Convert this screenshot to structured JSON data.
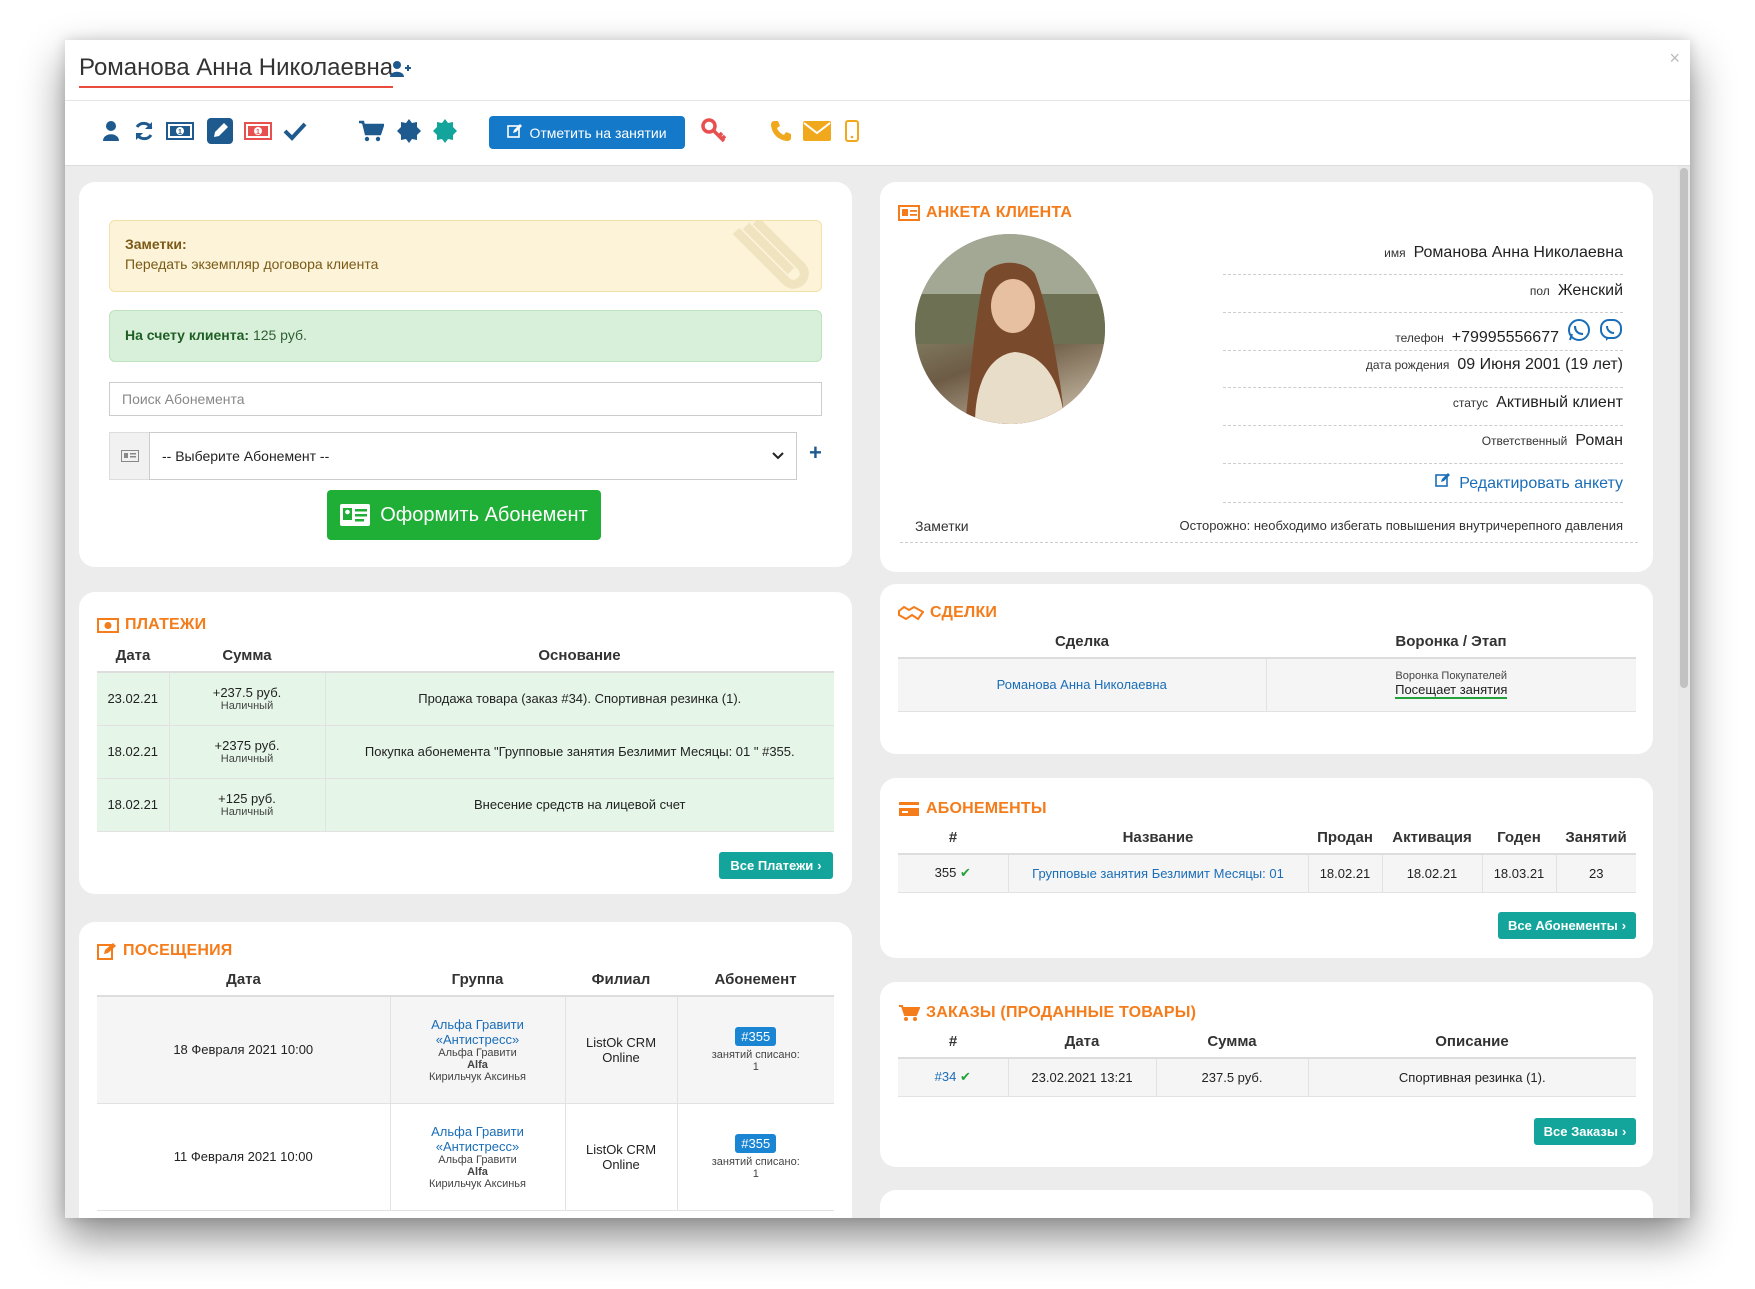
{
  "header": {
    "title": "Романова Анна Николаевна",
    "mark_button": "Отметить на занятии",
    "close": "×"
  },
  "notes": {
    "title": "Заметки:",
    "text": "Передать экземпляр договора клиента"
  },
  "balance": {
    "label": "На счету клиента:",
    "value": "125 руб."
  },
  "search": {
    "placeholder": "Поиск Абонемента"
  },
  "select": {
    "value": "-- Выберите Абонемент --",
    "add": "+"
  },
  "create_button": "Оформить Абонемент",
  "payments": {
    "title": "ПЛАТЕЖИ",
    "columns": [
      "Дата",
      "Сумма",
      "Основание"
    ],
    "rows": [
      {
        "date": "23.02.21",
        "sum": "+237.5 руб.",
        "method": "Наличный",
        "basis": "Продажа товара (заказ #34). Спортивная резинка (1)."
      },
      {
        "date": "18.02.21",
        "sum": "+2375 руб.",
        "method": "Наличный",
        "basis": "Покупка абонемента \"Групповые занятия Безлимит Месяцы: 01 \" #355."
      },
      {
        "date": "18.02.21",
        "sum": "+125 руб.",
        "method": "Наличный",
        "basis": "Внесение средств на лицевой счет"
      }
    ],
    "all_button": "Все Платежи"
  },
  "visits": {
    "title": "ПОСЕЩЕНИЯ",
    "columns": [
      "Дата",
      "Группа",
      "Филиал",
      "Абонемент"
    ],
    "rows": [
      {
        "date": "18 Февраля 2021 10:00",
        "group_link1": "Альфа Гравити",
        "group_link2": "«Антистресс»",
        "group_name": "Альфа Гравити",
        "hall": "Alfa",
        "trainer": "Кирильчук Аксинья",
        "branch1": "ListOk CRM",
        "branch2": "Online",
        "sub": "#355",
        "written1": "занятий списано:",
        "written2": "1"
      },
      {
        "date": "11 Февраля 2021 10:00",
        "group_link1": "Альфа Гравити",
        "group_link2": "«Антистресс»",
        "group_name": "Альфа Гравити",
        "hall": "Alfa",
        "trainer": "Кирильчук Аксинья",
        "branch1": "ListOk CRM",
        "branch2": "Online",
        "sub": "#355",
        "written1": "занятий списано:",
        "written2": "1"
      }
    ]
  },
  "profile": {
    "title": "АНКЕТА КЛИЕНТА",
    "fields": [
      {
        "label": "имя",
        "value": "Романова Анна Николаевна"
      },
      {
        "label": "пол",
        "value": "Женский"
      },
      {
        "label": "телефон",
        "value": "+79995556677"
      },
      {
        "label": "дата рождения",
        "value": "09 Июня 2001 (19 лет)"
      },
      {
        "label": "статус",
        "value": "Активный клиент"
      },
      {
        "label": "Ответственный",
        "value": "Роман"
      }
    ],
    "edit_link": "Редактировать анкету",
    "notes_label": "Заметки",
    "notes_value": "Осторожно: необходимо избегать повышения внутричерепного давления"
  },
  "deals": {
    "title": "СДЕЛКИ",
    "columns": [
      "Сделка",
      "Воронка / Этап"
    ],
    "row": {
      "deal": "Романова Анна Николаевна",
      "funnel": "Воронка Покупателей",
      "stage": "Посещает занятия"
    }
  },
  "subscriptions": {
    "title": "АБОНЕМЕНТЫ",
    "columns": [
      "#",
      "Название",
      "Продан",
      "Активация",
      "Годен",
      "Занятий"
    ],
    "row": {
      "num": "355",
      "name": "Групповые занятия Безлимит Месяцы: 01",
      "sold": "18.02.21",
      "activated": "18.02.21",
      "valid": "18.03.21",
      "lessons": "23"
    },
    "all_button": "Все Абонементы"
  },
  "orders": {
    "title": "ЗАКАЗЫ (ПРОДАННЫЕ ТОВАРЫ)",
    "columns": [
      "#",
      "Дата",
      "Сумма",
      "Описание"
    ],
    "row": {
      "num": "#34",
      "date": "23.02.2021 13:21",
      "sum": "237.5 руб.",
      "desc": "Спортивная резинка (1)."
    },
    "all_button": "Все Заказы"
  },
  "colors": {
    "accent": "#f47c1a",
    "primary": "#1479c9",
    "teal": "#13a59b",
    "green": "#1fae36"
  }
}
